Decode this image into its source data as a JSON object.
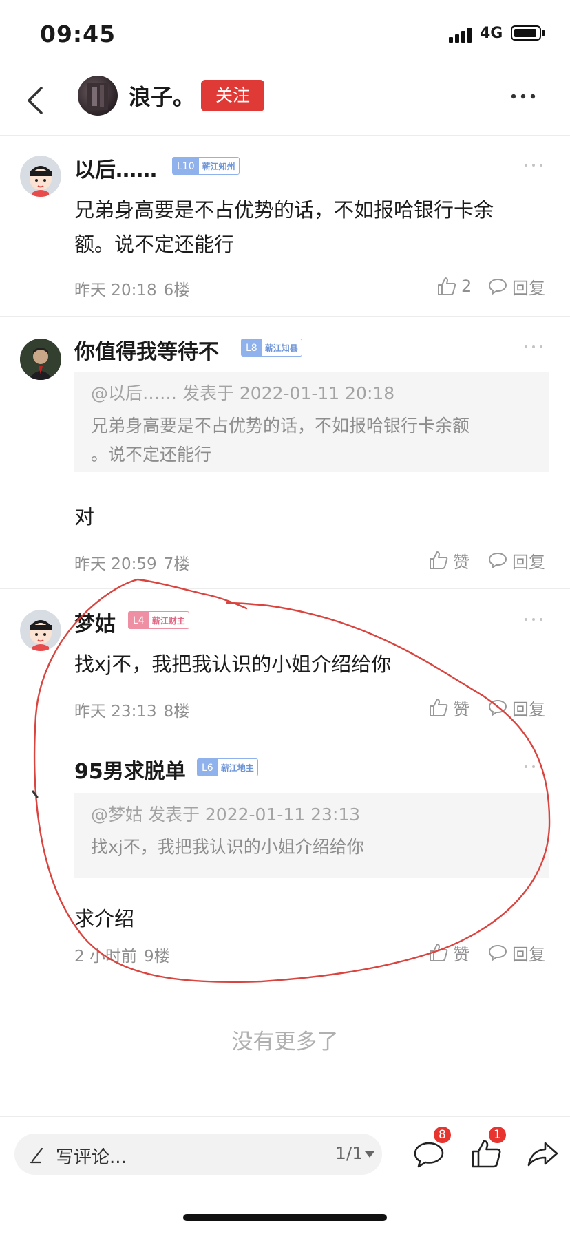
{
  "status_bar": {
    "time": "09:45",
    "network": "4G"
  },
  "nav": {
    "title": "浪子。",
    "follow_label": "关注"
  },
  "comments": [
    {
      "username": "以后……",
      "level": "L10",
      "level_title": "蕲江知州",
      "content": [
        "兄弟身高要是不占优势的话，不如报哈银行卡余",
        "额。说不定还能行"
      ],
      "time": "昨天 20:18",
      "floor": "6楼",
      "like_label": "2",
      "reply_label": "回复"
    },
    {
      "username": "你值得我等待不",
      "level": "L8",
      "level_title": "蕲江知县",
      "quote_head": "@以后…… 发表于 2022-01-11 20:18",
      "quote_body": [
        "兄弟身高要是不占优势的话，不如报哈银行卡余额",
        "。说不定还能行"
      ],
      "content": [
        "对"
      ],
      "time": "昨天 20:59",
      "floor": "7楼",
      "like_label": "赞",
      "reply_label": "回复"
    },
    {
      "username": "梦姑",
      "level": "L4",
      "level_title": "蕲江财主",
      "content": [
        "找xj不，我把我认识的小姐介绍给你"
      ],
      "time": "昨天 23:13",
      "floor": "8楼",
      "like_label": "赞",
      "reply_label": "回复"
    },
    {
      "username": "95男求脱单",
      "level": "L6",
      "level_title": "蕲江地主",
      "quote_head": "@梦姑 发表于 2022-01-11 23:13",
      "quote_body": [
        "找xj不，我把我认识的小姐介绍给你"
      ],
      "content": [
        "求介绍"
      ],
      "time": "2 小时前",
      "floor": "9楼",
      "like_label": "赞",
      "reply_label": "回复"
    }
  ],
  "no_more": "没有更多了",
  "bottom_bar": {
    "placeholder": "写评论...",
    "page_indicator": "1/1",
    "comment_count": "8",
    "like_count": "1"
  },
  "colors": {
    "accent_red": "#e03a36",
    "level_blue": "#8fb2ec",
    "level_pink": "#ef8fa4",
    "annotation_red": "#d9443f"
  }
}
